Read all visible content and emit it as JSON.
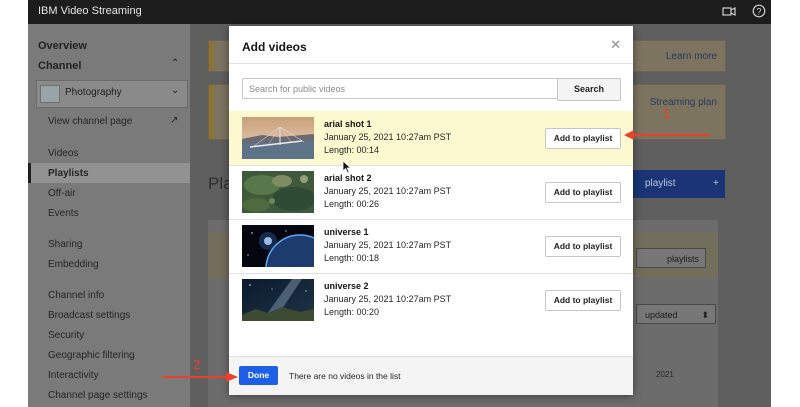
{
  "app": {
    "title": "IBM Video Streaming",
    "top_icons": [
      "camera-icon",
      "help-icon"
    ]
  },
  "sidebar": {
    "overview": "Overview",
    "channel_heading": "Channel",
    "channel_selected": "Photography",
    "items": [
      "View channel page",
      "Videos",
      "Playlists",
      "Off-air",
      "Events",
      "Sharing",
      "Embedding",
      "Channel info",
      "Broadcast settings",
      "Security",
      "Geographic filtering",
      "Interactivity",
      "Channel page settings"
    ],
    "active_item": "Playlists"
  },
  "background": {
    "alert1_link": "Learn more",
    "alert2_link": "Streaming plan",
    "page_title": "Pla",
    "new_playlist_label": "playlist",
    "playlists_btn": "playlists",
    "sort_btn": "updated",
    "date_fragment": "2021"
  },
  "modal": {
    "title": "Add videos",
    "search": {
      "placeholder": "Search for public videos",
      "value": "",
      "button": "Search"
    },
    "videos": [
      {
        "name": "arial shot 1",
        "date": "January 25, 2021 10:27am PST",
        "length": "Length: 00:14",
        "button": "Add to playlist",
        "highlighted": true
      },
      {
        "name": "arial shot 2",
        "date": "January 25, 2021 10:27am PST",
        "length": "Length: 00:26",
        "button": "Add to playlist",
        "highlighted": false
      },
      {
        "name": "universe 1",
        "date": "January 25, 2021 10:27am PST",
        "length": "Length: 00:18",
        "button": "Add to playlist",
        "highlighted": false
      },
      {
        "name": "universe 2",
        "date": "January 25, 2021 10:27am PST",
        "length": "Length: 00:20",
        "button": "Add to playlist",
        "highlighted": false
      }
    ],
    "done_label": "Done",
    "empty_message": "There are no videos in the list"
  },
  "annotations": {
    "step1": "1",
    "step2": "2",
    "arrow_color": "#e8412d"
  }
}
